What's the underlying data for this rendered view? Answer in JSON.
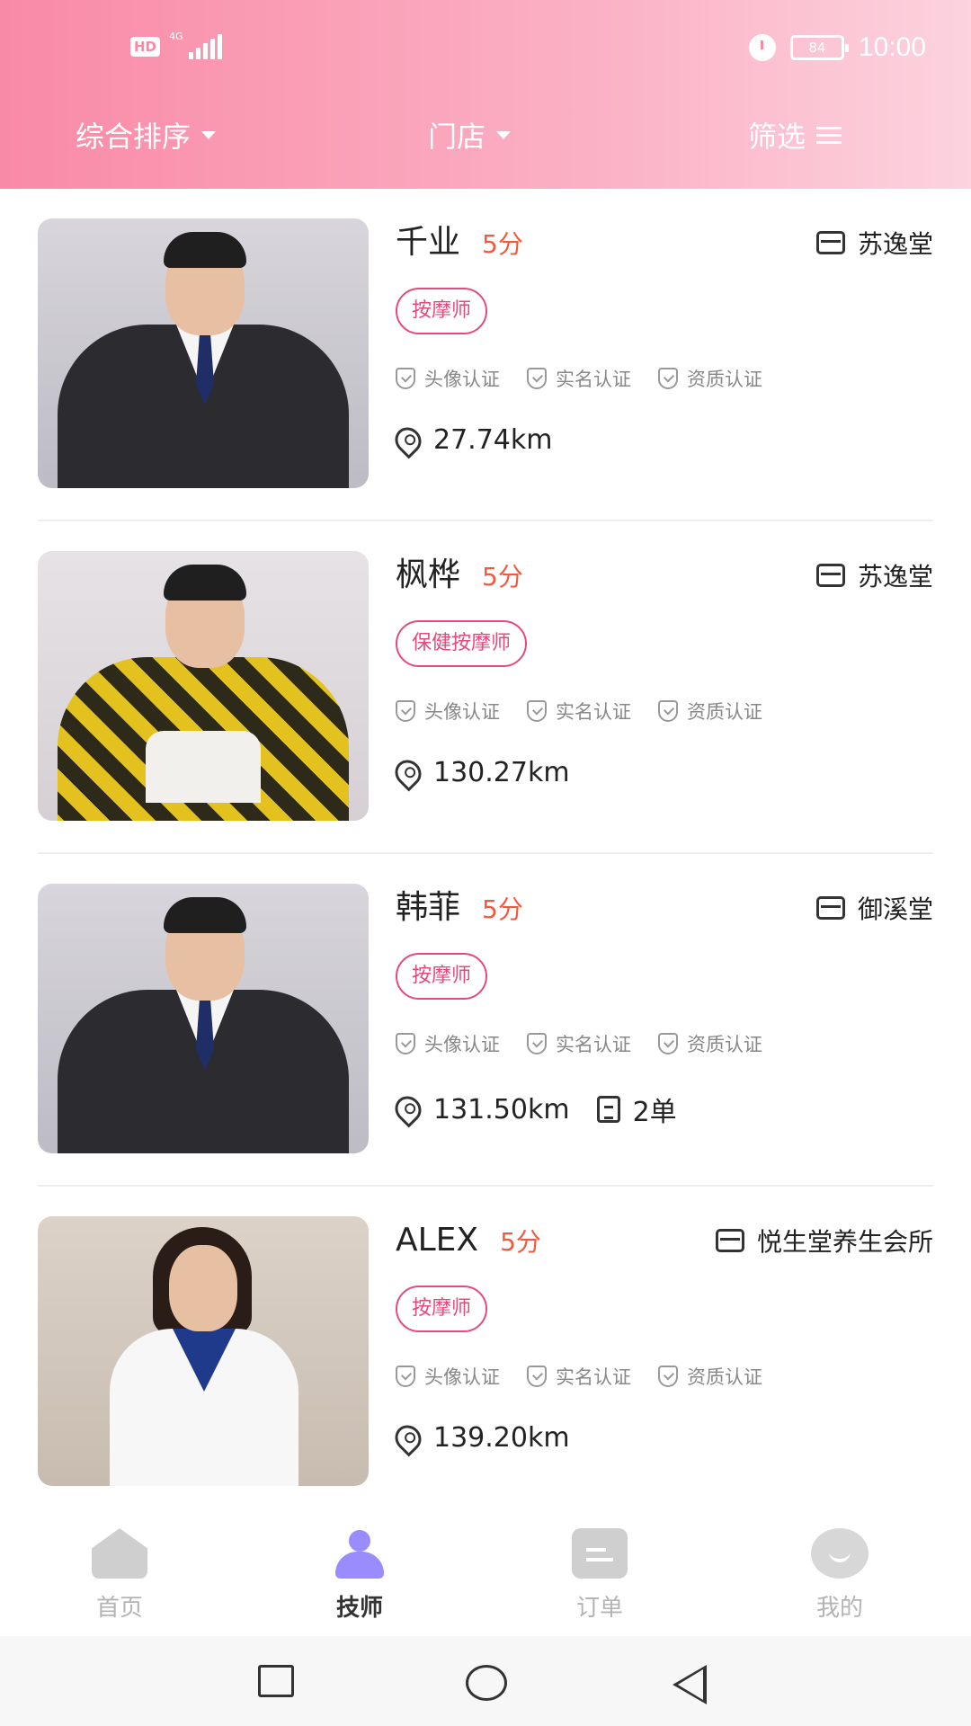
{
  "status_bar": {
    "hd": "HD",
    "network": "4G",
    "battery": "84",
    "time": "10:00"
  },
  "filters": {
    "sort_label": "综合排序",
    "store_label": "门店",
    "filter_label": "筛选"
  },
  "therapists": [
    {
      "name": "千业",
      "score": "5分",
      "store": "苏逸堂",
      "role": "按摩师",
      "certs": [
        "头像认证",
        "实名认证",
        "资质认证"
      ],
      "distance": "27.74km",
      "orders": ""
    },
    {
      "name": "枫桦",
      "score": "5分",
      "store": "苏逸堂",
      "role": "保健按摩师",
      "certs": [
        "头像认证",
        "实名认证",
        "资质认证"
      ],
      "distance": "130.27km",
      "orders": ""
    },
    {
      "name": "韩菲",
      "score": "5分",
      "store": "御溪堂",
      "role": "按摩师",
      "certs": [
        "头像认证",
        "实名认证",
        "资质认证"
      ],
      "distance": "131.50km",
      "orders": "2单"
    },
    {
      "name": "ALEX",
      "score": "5分",
      "store": "悦生堂养生会所",
      "role": "按摩师",
      "certs": [
        "头像认证",
        "实名认证",
        "资质认证"
      ],
      "distance": "139.20km",
      "orders": ""
    }
  ],
  "bottom_nav": [
    {
      "label": "首页",
      "icon": "home-icon",
      "active": false
    },
    {
      "label": "技师",
      "icon": "technician-icon",
      "active": true
    },
    {
      "label": "订单",
      "icon": "order-icon",
      "active": false
    },
    {
      "label": "我的",
      "icon": "profile-icon",
      "active": false
    }
  ],
  "colors": {
    "header_gradient_start": "#f98aa6",
    "header_gradient_end": "#fcd3de",
    "score": "#f05b3f",
    "role_tag": "#e64a7b",
    "active_nav_icon": "#9a8cff"
  }
}
